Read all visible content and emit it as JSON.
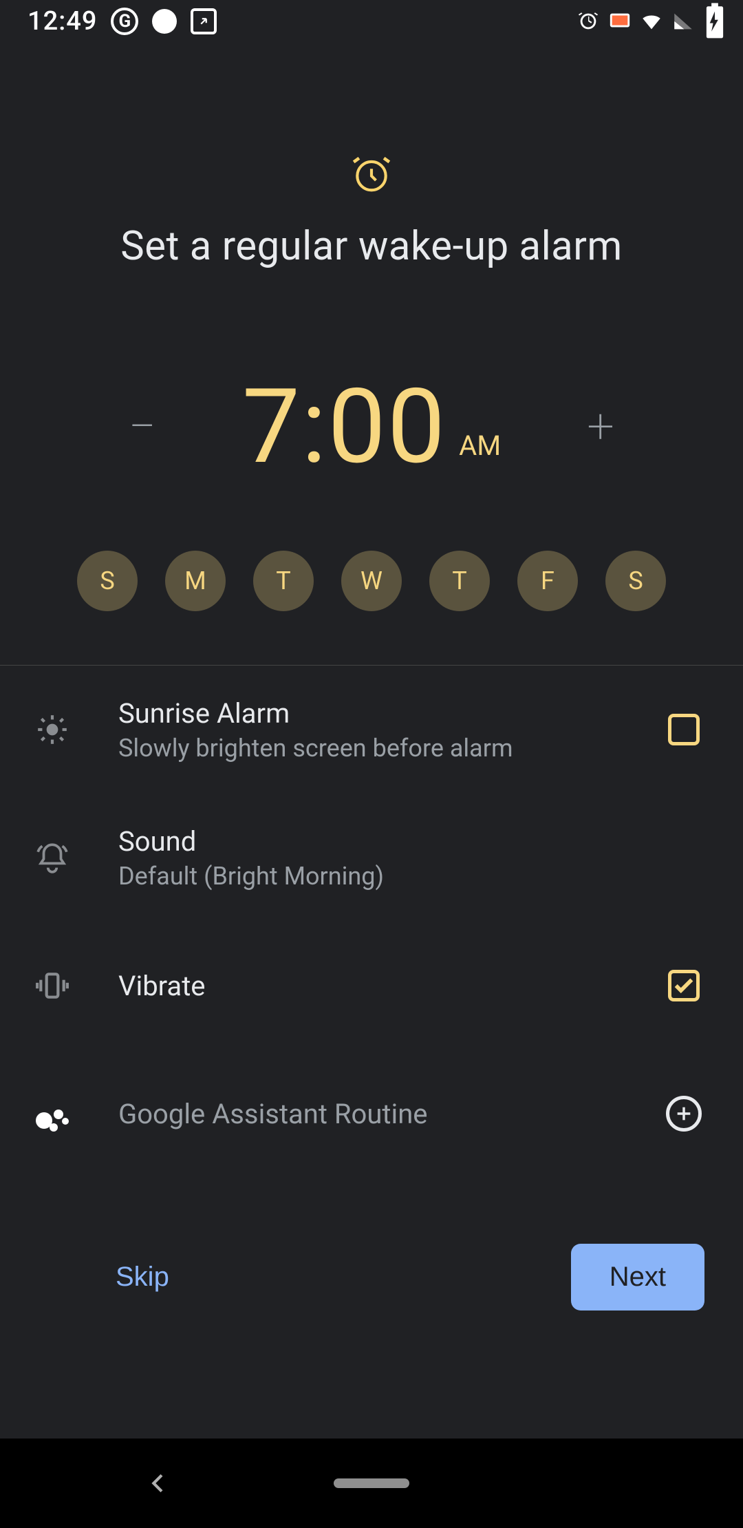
{
  "status": {
    "clock": "12:49"
  },
  "hero": {
    "title": "Set a regular wake-up alarm"
  },
  "time": {
    "value": "7:00",
    "ampm": "AM"
  },
  "days": [
    {
      "label": "S",
      "selected": true
    },
    {
      "label": "M",
      "selected": true
    },
    {
      "label": "T",
      "selected": true
    },
    {
      "label": "W",
      "selected": true
    },
    {
      "label": "T",
      "selected": true
    },
    {
      "label": "F",
      "selected": true
    },
    {
      "label": "S",
      "selected": true
    }
  ],
  "settings": {
    "sunrise": {
      "title": "Sunrise Alarm",
      "subtitle": "Slowly brighten screen before alarm",
      "checked": false
    },
    "sound": {
      "title": "Sound",
      "subtitle": "Default (Bright Morning)"
    },
    "vibrate": {
      "title": "Vibrate",
      "checked": true
    },
    "assistant": {
      "title": "Google Assistant Routine"
    }
  },
  "footer": {
    "skip": "Skip",
    "next": "Next"
  },
  "colors": {
    "accent": "#f7d781",
    "blue": "#8ab4f8",
    "bg": "#202124"
  }
}
